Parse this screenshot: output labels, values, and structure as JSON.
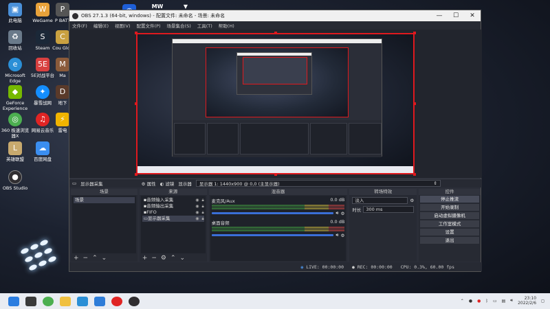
{
  "desktop": {
    "icons": [
      {
        "label": "此电脑",
        "icon": "computer-icon",
        "color": "#4a90d9"
      },
      {
        "label": "WeGame",
        "icon": "wegame-icon",
        "color": "#e8a23a"
      },
      {
        "label": "P BATT",
        "icon": "game-icon",
        "color": "#666"
      },
      {
        "label": "回收站",
        "icon": "recycle-bin-icon",
        "color": "#6a7a8a"
      },
      {
        "label": "Steam",
        "icon": "steam-icon",
        "color": "#1b2838"
      },
      {
        "label": "Cou Glob",
        "icon": "game-icon",
        "color": "#c9a040"
      },
      {
        "label": "Microsoft Edge",
        "icon": "edge-icon",
        "color": "#2b8fd6"
      },
      {
        "label": "5E对战平台",
        "icon": "5e-icon",
        "color": "#d84040"
      },
      {
        "label": "Ma",
        "icon": "game-icon",
        "color": "#8a5a3a"
      },
      {
        "label": "GeForce Experience",
        "icon": "geforce-icon",
        "color": "#76b900"
      },
      {
        "label": "暴雪战网",
        "icon": "battlenet-icon",
        "color": "#148eff"
      },
      {
        "label": "地下",
        "icon": "game-icon",
        "color": "#5a3a2a"
      },
      {
        "label": "360 极速浏览器X",
        "icon": "browser-icon",
        "color": "#4caf50"
      },
      {
        "label": "网易云音乐",
        "icon": "music-icon",
        "color": "#e02424"
      },
      {
        "label": "雷电",
        "icon": "emulator-icon",
        "color": "#f0b400"
      },
      {
        "label": "英雄联盟",
        "icon": "lol-icon",
        "color": "#c8aa6e"
      },
      {
        "label": "百度网盘",
        "icon": "cloud-icon",
        "color": "#3b8ef0"
      },
      {
        "label": "OBS Studio",
        "icon": "obs-icon",
        "color": "#302e31"
      }
    ],
    "partial_top": [
      "MW",
      "▼"
    ]
  },
  "window": {
    "title": "OBS 27.1.3 (64-bit, windows) - 配置文件: 未命名 - 场景: 未命名",
    "controls": [
      "—",
      "☐",
      "✕"
    ],
    "menu": [
      "文件(F)",
      "编辑(E)",
      "视图(V)",
      "配置文件(P)",
      "场景集合(S)",
      "工具(T)",
      "帮助(H)"
    ]
  },
  "source_bar": {
    "source_name": "显示器采集",
    "properties": "属性",
    "filters": "滤镜",
    "display_label": "显示器",
    "display_value": "显示器 1: 1440x900 @ 0,0 (主显示器)"
  },
  "scenes": {
    "title": "场景",
    "items": [
      "场景"
    ]
  },
  "sources": {
    "title": "来源",
    "items": [
      {
        "name": "音频输入采集"
      },
      {
        "name": "音频输出采集"
      },
      {
        "name": "FIFO"
      },
      {
        "name": "显示器采集"
      }
    ]
  },
  "mixer": {
    "title": "混音器",
    "channels": [
      {
        "name": "麦克风/Aux",
        "db": "0.0 dB"
      },
      {
        "name": "桌面音频",
        "db": "0.0 dB"
      }
    ]
  },
  "transitions": {
    "title": "转场特效",
    "type": "淡入",
    "duration_label": "时长",
    "duration": "300 ms"
  },
  "controls": {
    "title": "控件",
    "buttons": [
      "停止推流",
      "开始录制",
      "启动虚拟摄像机",
      "工作室模式",
      "设置",
      "退出"
    ]
  },
  "status": {
    "live": "LIVE: 00:00:00",
    "rec": "REC: 00:00:00",
    "cpu": "CPU: 0.3%, 60.00 fps"
  },
  "taskbar": {
    "time": "23:10",
    "date": "2022/2/6"
  },
  "colors": {
    "accent_red": "#e0191e",
    "meter_green": "#3d8f3d",
    "fader_blue": "#3a6fd8"
  }
}
